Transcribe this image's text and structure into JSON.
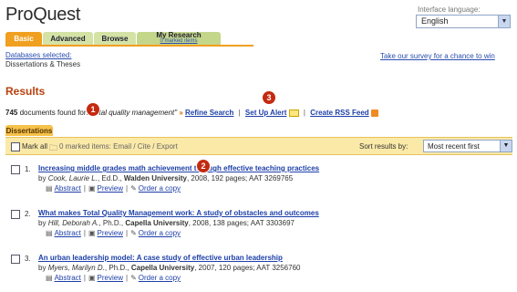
{
  "header": {
    "logo": "ProQuest",
    "interface_language_label": "Interface language:",
    "language_value": "English"
  },
  "tabs": [
    {
      "label": "Basic"
    },
    {
      "label": "Advanced"
    },
    {
      "label": "Browse"
    },
    {
      "label": "My Research",
      "sub": "0 marked items"
    }
  ],
  "databases": {
    "selected_link": "Databases selected:",
    "name": "Dissertations & Theses",
    "survey_link": "Take our survey for a chance to win"
  },
  "results": {
    "heading": "Results",
    "count": "745",
    "documents_text": "documents",
    "found_for": "found for:",
    "query": "\"total quality management\"",
    "refine_label": "Refine Search",
    "alert_label": "Set Up Alert",
    "rss_label": "Create RSS Feed",
    "subtab": "Dissertations"
  },
  "toolbar": {
    "mark_all": "Mark all",
    "marked_items": "0 marked items: Email / Cite / Export",
    "sort_label": "Sort results by:",
    "sort_value": "Most recent first"
  },
  "items": [
    {
      "num": "1.",
      "title": "Increasing middle grades math achievement through effective teaching practices",
      "by": "by",
      "author": "Cook, Laurie L.",
      "degree": ", Ed.D.,",
      "univ": "Walden University",
      "details": ", 2008, 192 pages; AAT 3269765"
    },
    {
      "num": "2.",
      "title": "What makes Total Quality Management work: A study of obstacles and outcomes",
      "by": "by",
      "author": "Hill, Deborah A.",
      "degree": ", Ph.D.,",
      "univ": "Capella University",
      "details": ", 2008, 138 pages; AAT 3303697"
    },
    {
      "num": "3.",
      "title": "An urban leadership model: A case study of effective urban leadership",
      "by": "by",
      "author": "Myers, Marilyn D.",
      "degree": ", Ph.D.,",
      "univ": "Capella University",
      "details": ", 2007, 120 pages; AAT 3256760"
    }
  ],
  "item_links": {
    "abstract": "Abstract",
    "preview": "Preview",
    "order": "Order a copy"
  },
  "annotations": [
    "1",
    "2",
    "3"
  ],
  "colors": {
    "accent_orange": "#f0a020",
    "results_heading": "#b7410e",
    "link_blue": "#1d3fa8",
    "toolbar_bg": "#fbe9a8",
    "annotation_red": "#c42a10"
  }
}
